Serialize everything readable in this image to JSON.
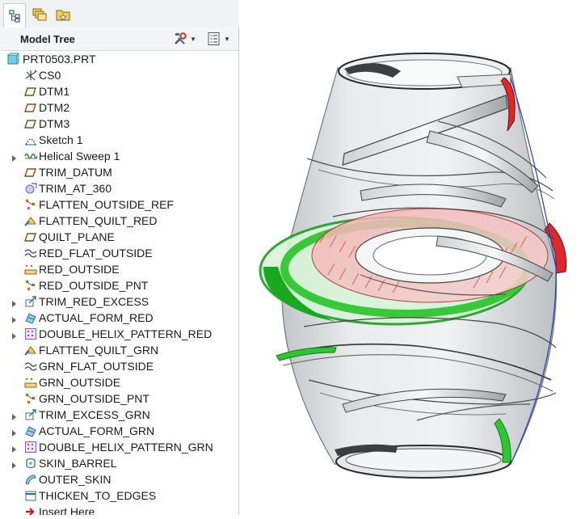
{
  "tabs": [
    {
      "icon": "model-tree-icon"
    },
    {
      "icon": "layers-icon"
    },
    {
      "icon": "favorites-folder-icon"
    }
  ],
  "tree_header": {
    "title": "Model Tree",
    "settings_icon": "tools-icon",
    "columns_icon": "show-columns-icon"
  },
  "tree": {
    "root": "PRT0503.PRT",
    "items": [
      {
        "label": "CS0",
        "icon": "coordinate-system-icon",
        "expandable": false
      },
      {
        "label": "DTM1",
        "icon": "datum-plane-icon",
        "expandable": false
      },
      {
        "label": "DTM2",
        "icon": "datum-plane-icon",
        "expandable": false
      },
      {
        "label": "DTM3",
        "icon": "datum-plane-icon",
        "expandable": false
      },
      {
        "label": "Sketch 1",
        "icon": "sketch-icon",
        "expandable": false
      },
      {
        "label": "Helical Sweep 1",
        "icon": "helical-sweep-icon",
        "expandable": true
      },
      {
        "label": "TRIM_DATUM",
        "icon": "datum-plane-icon",
        "expandable": false
      },
      {
        "label": "TRIM_AT_360",
        "icon": "datum-point-icon",
        "expandable": false
      },
      {
        "label": "FLATTEN_OUTSIDE_REF",
        "icon": "reference-points-icon",
        "expandable": false
      },
      {
        "label": "FLATTEN_QUILT_RED",
        "icon": "flatten-quilt-icon",
        "expandable": false
      },
      {
        "label": "QUILT_PLANE",
        "icon": "datum-plane-icon",
        "expandable": false
      },
      {
        "label": "RED_FLAT_OUTSIDE",
        "icon": "curve-icon",
        "expandable": false
      },
      {
        "label": "RED_OUTSIDE",
        "icon": "point-set-icon",
        "expandable": false
      },
      {
        "label": "RED_OUTSIDE_PNT",
        "icon": "reference-points-icon",
        "expandable": false
      },
      {
        "label": "TRIM_RED_EXCESS",
        "icon": "trim-icon",
        "expandable": true
      },
      {
        "label": "ACTUAL_FORM_RED",
        "icon": "form-icon",
        "expandable": true
      },
      {
        "label": "DOUBLE_HELIX_PATTERN_RED",
        "icon": "pattern-icon",
        "expandable": true
      },
      {
        "label": "FLATTEN_QUILT_GRN",
        "icon": "flatten-quilt-icon",
        "expandable": false
      },
      {
        "label": "GRN_FLAT_OUTSIDE",
        "icon": "curve-icon",
        "expandable": false
      },
      {
        "label": "GRN_OUTSIDE",
        "icon": "point-set-icon",
        "expandable": false
      },
      {
        "label": "GRN_OUTSIDE_PNT",
        "icon": "reference-points-icon",
        "expandable": false
      },
      {
        "label": "TRIM_EXCESS_GRN",
        "icon": "trim-icon",
        "expandable": true
      },
      {
        "label": "ACTUAL_FORM_GRN",
        "icon": "form-icon",
        "expandable": true
      },
      {
        "label": "DOUBLE_HELIX_PATTERN_GRN",
        "icon": "pattern-icon",
        "expandable": true
      },
      {
        "label": "SKIN_BARREL",
        "icon": "blend-icon",
        "expandable": true
      },
      {
        "label": "OUTER_SKIN",
        "icon": "surface-icon",
        "expandable": false
      },
      {
        "label": "THICKEN_TO_EDGES",
        "icon": "thicken-icon",
        "expandable": false
      },
      {
        "label": "Insert Here",
        "icon": "insert-arrow-icon",
        "expandable": false
      }
    ]
  },
  "colors": {
    "red_feature": "#e0282a",
    "green_feature": "#2ec632",
    "body": "#d6d9dc",
    "edge": "#2a2a2a",
    "datum_curve": "#1f3fbf"
  }
}
